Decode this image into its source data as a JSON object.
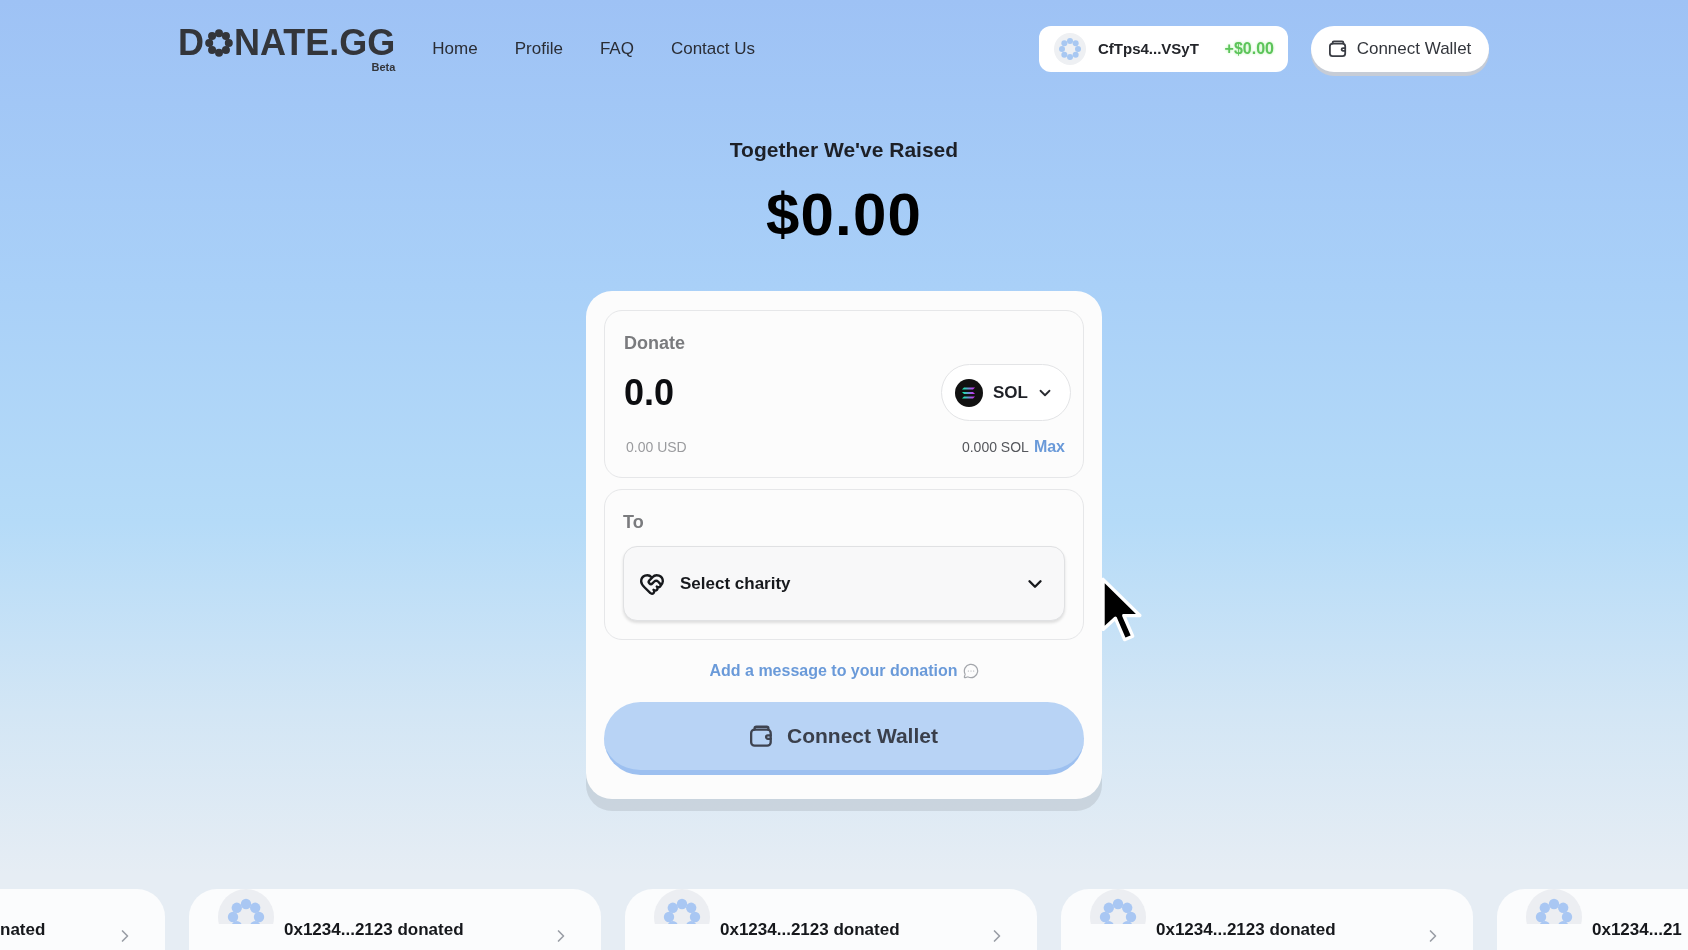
{
  "header": {
    "logo": {
      "lead": "D",
      "rest": "NATE.GG",
      "tag": "Beta"
    },
    "nav": [
      "Home",
      "Profile",
      "FAQ",
      "Contact Us"
    ],
    "wallet_badge": {
      "address": "CfTps4...VSyT",
      "balance": "+$0.00"
    },
    "connect_button": "Connect Wallet"
  },
  "hero": {
    "title": "Together We've Raised",
    "amount": "$0.00"
  },
  "donate_form": {
    "donate_panel": {
      "label": "Donate",
      "amount": "0.0",
      "token": "SOL",
      "usd_value": "0.00 USD",
      "balance": "0.000 SOL",
      "max_label": "Max"
    },
    "to_panel": {
      "label": "To",
      "select": {
        "placeholder": "Select charity"
      }
    },
    "message_link": "Add a message to your donation",
    "submit_button": "Connect Wallet"
  },
  "recent_donations": [
    {
      "kind": "cut_left",
      "text": "nated"
    },
    {
      "kind": "full",
      "text": "0x1234...2123 donated"
    },
    {
      "kind": "full",
      "text": "0x1234...2123 donated"
    },
    {
      "kind": "full",
      "text": "0x1234...2123 donated"
    },
    {
      "kind": "cut_right",
      "text": "0x1234...21"
    }
  ]
}
